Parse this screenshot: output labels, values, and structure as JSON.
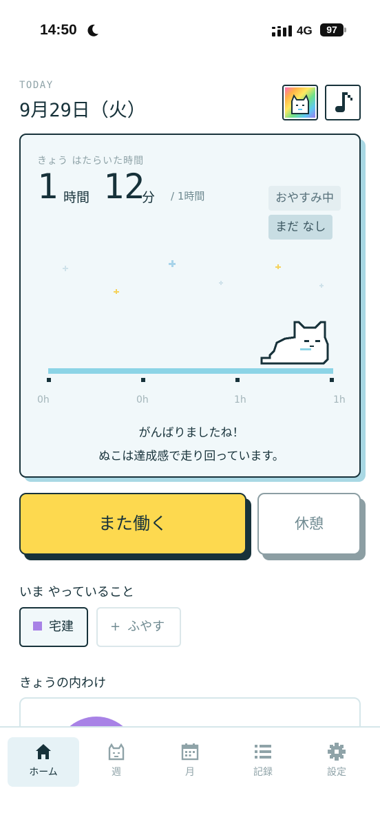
{
  "status": {
    "time": "14:50",
    "network": "4G",
    "battery": "97",
    "icons": [
      "moon-icon",
      "signal-icon"
    ]
  },
  "header": {
    "today_label": "TODAY",
    "date": "9月29日（火）"
  },
  "work_card": {
    "label": "きょう はたらいた時間",
    "hours": "1",
    "hours_unit": "時間",
    "minutes": "12",
    "minutes_unit": "分",
    "goal": "/ 1時間",
    "status_pill": "おやすみ中",
    "break_pill": "まだ なし",
    "progress": 1.0,
    "tick_labels": [
      "0h",
      "0h",
      "1h",
      "1h"
    ],
    "message_line1": "がんばりましたね！",
    "message_line2": "ぬこは達成感で走り回っています。"
  },
  "actions": {
    "work_again": "また働く",
    "rest": "休憩"
  },
  "doing": {
    "title": "いま やっていること",
    "active_item": "宅建",
    "active_color": "#a882e6",
    "add_label": "ふやす",
    "add_prefix": "+"
  },
  "breakdown": {
    "title": "きょうの内わけ"
  },
  "tabs": [
    {
      "label": "ホーム",
      "icon": "home-icon",
      "active": true
    },
    {
      "label": "週",
      "icon": "cat-face-icon",
      "active": false
    },
    {
      "label": "月",
      "icon": "calendar-icon",
      "active": false
    },
    {
      "label": "記録",
      "icon": "list-icon",
      "active": false
    },
    {
      "label": "設定",
      "icon": "gear-icon",
      "active": false
    }
  ],
  "colors": {
    "ink": "#17323a",
    "accent_yellow": "#fdd94f",
    "progress_blue": "#8cd4e6",
    "card_bg": "#f1f8fa",
    "purple": "#a882e6"
  }
}
